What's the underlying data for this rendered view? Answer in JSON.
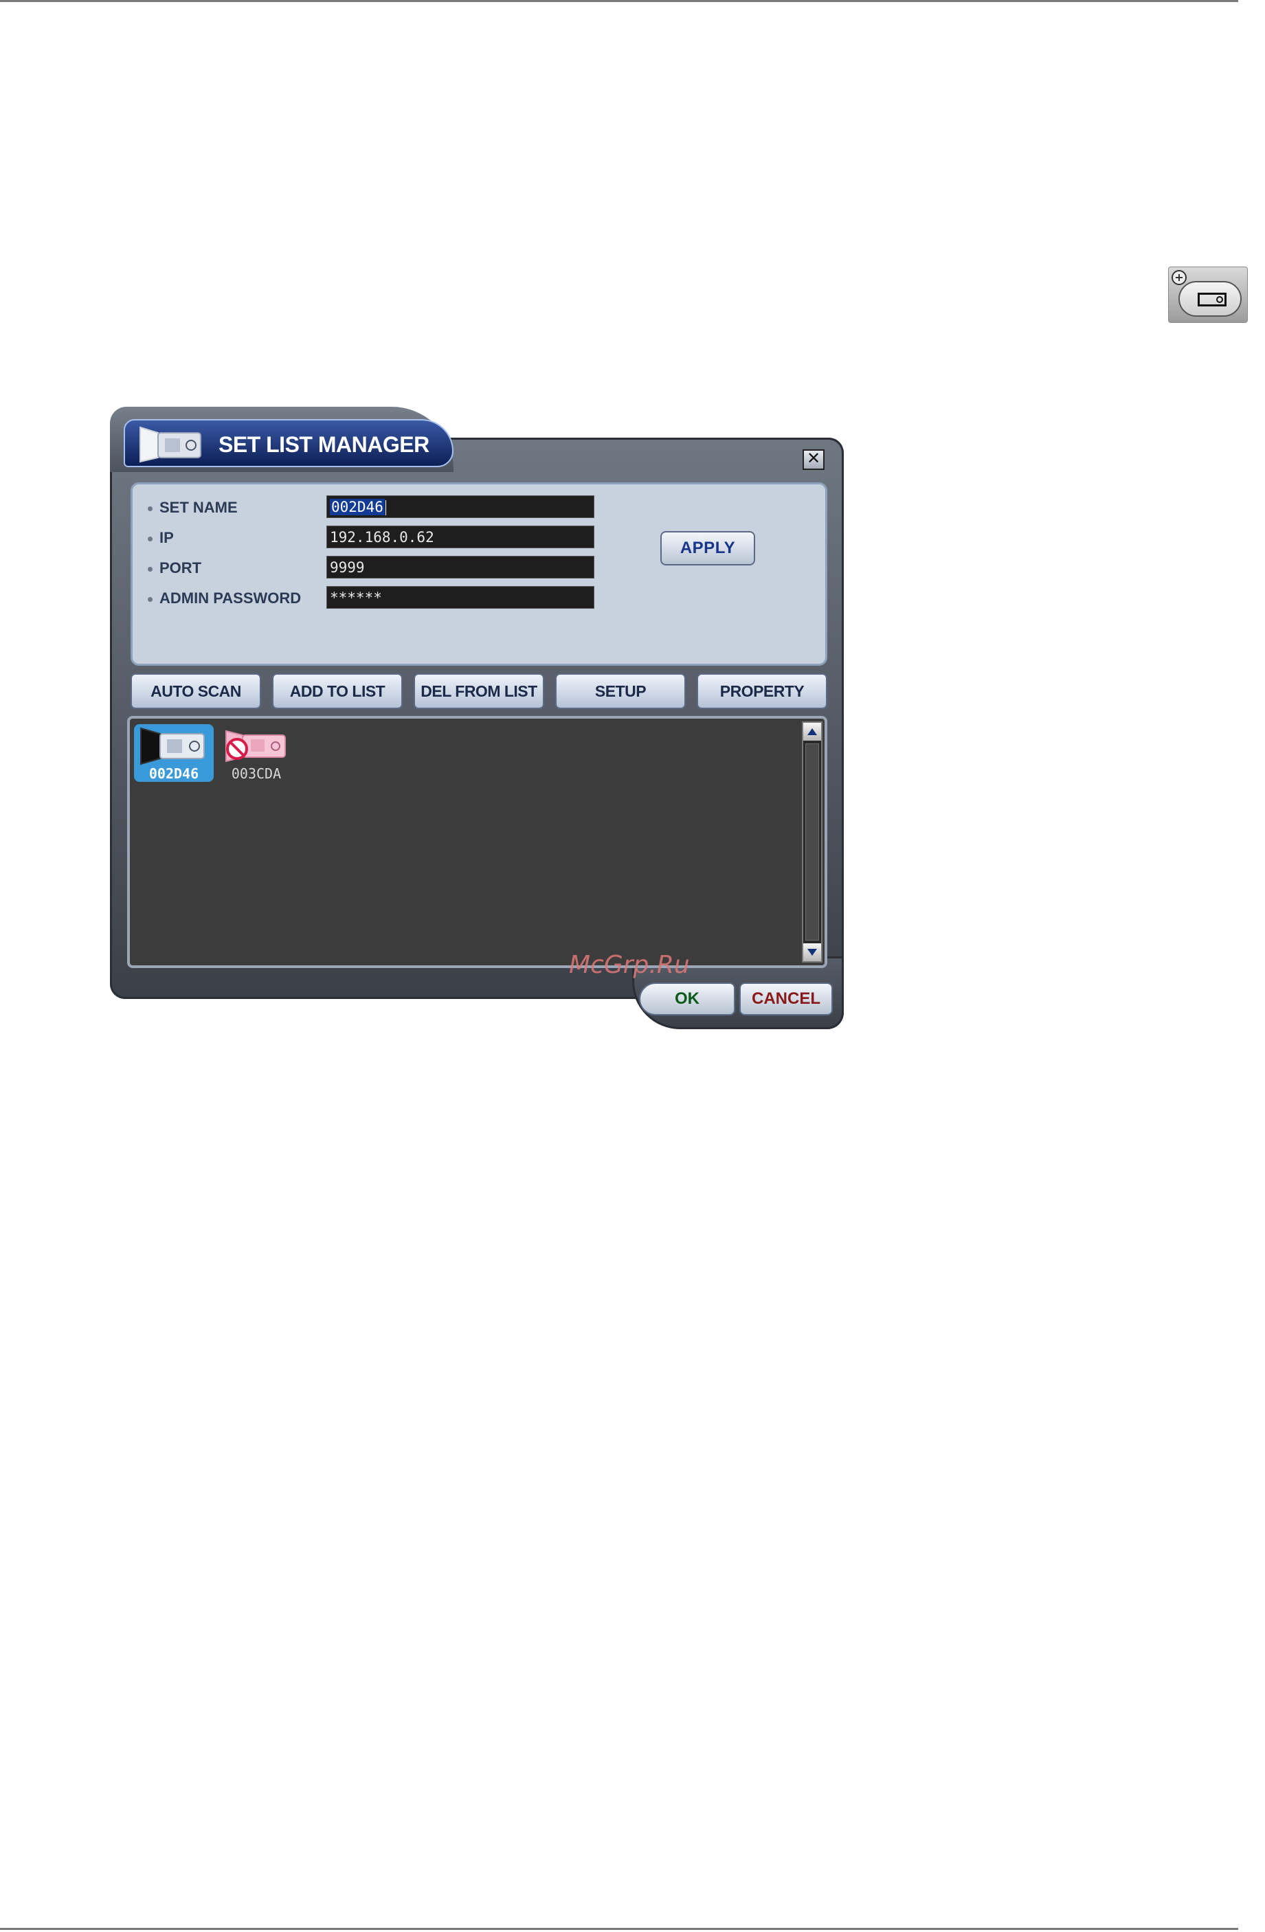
{
  "dialog": {
    "title": "SET LIST MANAGER",
    "close_glyph": "✕"
  },
  "toolbar_icon": "add-set-icon",
  "settings": {
    "fields": [
      {
        "label": "SET NAME",
        "value": "002D46"
      },
      {
        "label": "IP",
        "value": "192.168.0.62"
      },
      {
        "label": "PORT",
        "value": "9999"
      },
      {
        "label": "ADMIN PASSWORD",
        "value": "******"
      }
    ],
    "apply_label": "APPLY"
  },
  "actions": [
    "AUTO SCAN",
    "ADD TO LIST",
    "DEL FROM LIST",
    "SETUP",
    "PROPERTY"
  ],
  "set_list": [
    {
      "name": "002D46",
      "state": "selected",
      "icon": "dvr-camera-icon"
    },
    {
      "name": "003CDA",
      "state": "offline",
      "icon": "dvr-camera-disconnected-icon"
    }
  ],
  "footer": {
    "ok_label": "OK",
    "cancel_label": "CANCEL"
  },
  "watermark": "McGrp.Ru",
  "colors": {
    "title_bar": "#0d1f55",
    "selected_item": "#3a9ad9",
    "ok_text": "#0c5a1a",
    "cancel_text": "#8a1a1a"
  }
}
